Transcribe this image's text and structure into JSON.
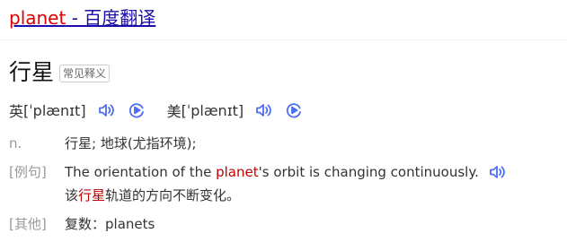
{
  "title": {
    "keyword": "planet",
    "suffix": " - 百度翻译"
  },
  "headword": {
    "word": "行星",
    "tag": "常见释义"
  },
  "phonetics": [
    {
      "region": "英",
      "ipa": "[ˈplænɪt]"
    },
    {
      "region": "美",
      "ipa": "[ˈplænɪt]"
    }
  ],
  "definition": {
    "pos": "n.",
    "text": "行星; 地球(尤指环境);"
  },
  "example": {
    "label": "[例句]",
    "en_before": "The orientation of the ",
    "en_keyword": "planet",
    "en_after": "'s orbit is changing continuously.",
    "zh_before": "该",
    "zh_keyword": "行星",
    "zh_after": "轨道的方向不断变化。"
  },
  "other": {
    "label": "[其他]",
    "text": "复数：planets"
  },
  "colors": {
    "link": "#1a0dab",
    "keyword": "#e00000",
    "icon": "#4e6ef2"
  },
  "icons": {
    "speaker": "speaker-icon",
    "play": "play-icon"
  }
}
